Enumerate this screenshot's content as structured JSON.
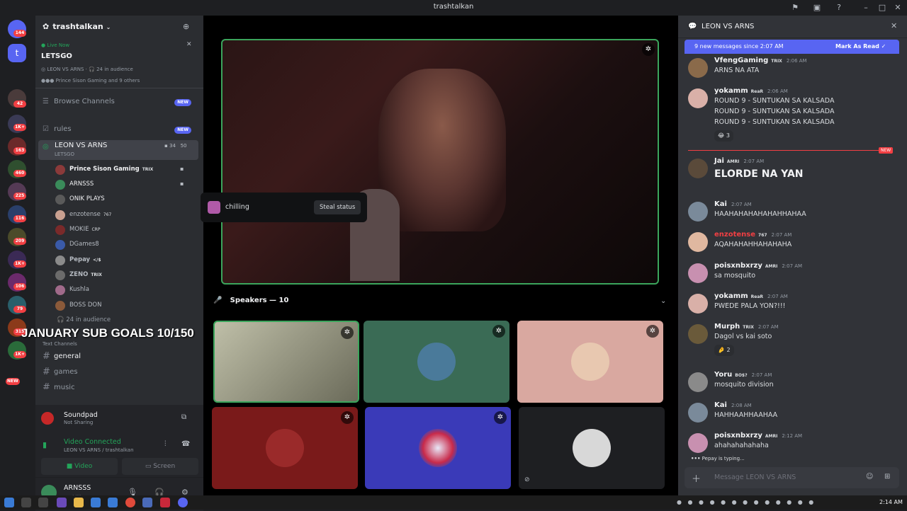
{
  "window": {
    "title": "trashtalkan"
  },
  "servers": [
    {
      "badge": "144"
    },
    {
      "badge": ""
    },
    {
      "badge": "42"
    },
    {
      "badge": "1K+"
    },
    {
      "badge": "163"
    },
    {
      "badge": "460"
    },
    {
      "badge": "225"
    },
    {
      "badge": "116"
    },
    {
      "badge": "209"
    },
    {
      "badge": "1K+"
    },
    {
      "badge": "106"
    },
    {
      "badge": "79"
    },
    {
      "badge": "315"
    },
    {
      "badge": "1K+"
    },
    {
      "badge": "NEW"
    }
  ],
  "server": {
    "name": "trashtalkan"
  },
  "live": {
    "status": "Live Now",
    "event": "LETSGO",
    "channel": "LEON VS ARNS",
    "audience": "24 in audience",
    "viewers": "Prince Sison Gaming and 9 others"
  },
  "channels": {
    "browse": "Browse Channels",
    "browse_badge": "NEW",
    "rules": "rules",
    "rules_badge": "NEW",
    "stage_name": "LEON VS ARNS",
    "stage_topic": "LETSGO",
    "stage_speakers": "34",
    "stage_listeners": "50",
    "in_audience": "24 in audience",
    "text_category": "Text Channels",
    "general": "general",
    "games": "games",
    "music": "music"
  },
  "members": [
    {
      "name": "Prince Sison Gaming",
      "tag": "TRIX"
    },
    {
      "name": "ARNSSS",
      "tag": ""
    },
    {
      "name": "ONIK PLAYS",
      "tag": ""
    },
    {
      "name": "enzotense",
      "tag": "767"
    },
    {
      "name": "MOKIE",
      "tag": "CRP"
    },
    {
      "name": "DGames8",
      "tag": ""
    },
    {
      "name": "Pepay",
      "tag": "</$"
    },
    {
      "name": "ZENO",
      "tag": "TRIX"
    },
    {
      "name": "Kushla",
      "tag": ""
    },
    {
      "name": "BOSS DON",
      "tag": ""
    }
  ],
  "overlay": {
    "text": "JANUARY SUB GOALS 10/150"
  },
  "soundpad": {
    "name": "Soundpad",
    "status": "Not Sharing"
  },
  "voice": {
    "status": "Video Connected",
    "location": "LEON VS ARNS / trashtalkan",
    "video_label": "Video",
    "screen_label": "Screen"
  },
  "user": {
    "name": "ARNSSS",
    "status": "chilling"
  },
  "popup": {
    "status": "chilling",
    "action": "Steal status"
  },
  "stage": {
    "speakers_label": "Speakers — 10"
  },
  "chat": {
    "channel": "LEON VS ARNS",
    "new_banner": "9 new messages since 2:07 AM",
    "mark_read": "Mark As Read",
    "new_divider": "NEW",
    "placeholder": "Message LEON VS ARNS",
    "typing": "Pepay is typing...",
    "messages": [
      {
        "author": "VfengGaming",
        "role": "TRIX",
        "time": "2:06 AM",
        "lines": [
          "ARNS NA ATA"
        ]
      },
      {
        "author": "yokamm",
        "role": "ReaR",
        "time": "2:06 AM",
        "lines": [
          "ROUND 9 - SUNTUKAN SA KALSADA",
          "ROUND 9 - SUNTUKAN SA KALSADA",
          "ROUND 9 - SUNTUKAN SA KALSADA"
        ],
        "reaction": "3"
      },
      {
        "author": "Jai",
        "role": "AMRI",
        "time": "2:07 AM",
        "lines": [
          "ELORDE NA YAN"
        ]
      },
      {
        "author": "Kai",
        "role": "",
        "time": "2:07 AM",
        "lines": [
          "HAAHAHAHAHAHAHHAHAA"
        ]
      },
      {
        "author": "enzotense",
        "role": "767",
        "time": "2:07 AM",
        "lines": [
          "AQAHAHAHHAHAHAHA"
        ]
      },
      {
        "author": "poisxnbxrzy",
        "role": "AMRI",
        "time": "2:07 AM",
        "lines": [
          "sa mosquito"
        ]
      },
      {
        "author": "yokamm",
        "role": "ReaR",
        "time": "2:07 AM",
        "lines": [
          "PWEDE PALA YON?!!!"
        ]
      },
      {
        "author": "Murph",
        "role": "TRIX",
        "time": "2:07 AM",
        "lines": [
          "Dagol vs kai soto"
        ],
        "reaction": "2"
      },
      {
        "author": "Yoru",
        "role": "BO$?",
        "time": "2:07 AM",
        "lines": [
          "mosquito division"
        ]
      },
      {
        "author": "Kai",
        "role": "",
        "time": "2:08 AM",
        "lines": [
          "HAHHAAHHAAHAA"
        ]
      },
      {
        "author": "poisxnbxrzy",
        "role": "AMRI",
        "time": "2:12 AM",
        "lines": [
          "ahahahahahaha"
        ]
      }
    ]
  },
  "taskbar": {
    "time": "2:14 AM"
  },
  "colors": {
    "accent": "#5865f2",
    "green": "#23a55a",
    "red": "#f23f43",
    "background": "#313338"
  }
}
